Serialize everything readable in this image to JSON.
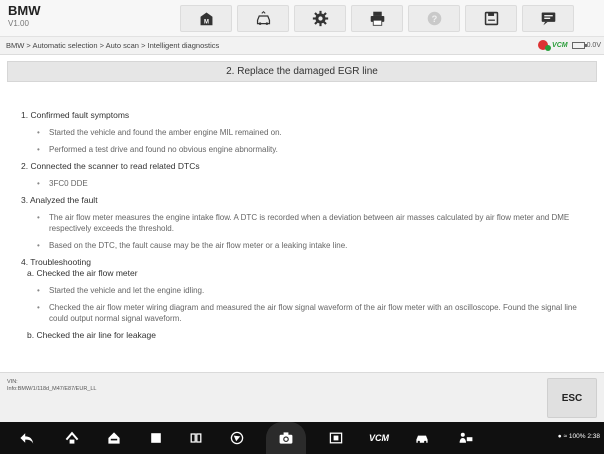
{
  "app": {
    "name": "BMW",
    "version": "V1.00"
  },
  "toolbar": {
    "icons": [
      "home-icon",
      "car-icon",
      "settings-icon",
      "print-icon",
      "help-icon",
      "save-icon",
      "message-icon"
    ]
  },
  "breadcrumb": "BMW > Automatic selection > Auto scan > Intelligent diagnostics",
  "status": {
    "vcm_label": "VCM",
    "voltage": "0.0V"
  },
  "title": "2. Replace the damaged EGR line",
  "content": {
    "s1": "1. Confirmed fault symptoms",
    "s1_b1": "Started the vehicle and found the amber engine MIL remained on.",
    "s1_b2": "Performed a test drive and found no obvious engine abnormality.",
    "s2": "2. Connected the scanner to read related DTCs",
    "s2_b1": "3FC0 DDE",
    "s3": "3. Analyzed the fault",
    "s3_b1": "The air flow meter measures the engine intake flow. A DTC is recorded when a deviation between air masses calculated by air flow meter and DME respectively exceeds the threshold.",
    "s3_b2": "Based on the DTC, the fault cause may be the air flow meter or a leaking intake line.",
    "s4": "4. Troubleshooting",
    "s4a": "a. Checked the air flow meter",
    "s4a_b1": "Started the vehicle and let the engine idling.",
    "s4a_b2": "Checked the air flow meter wiring diagram and measured the air flow signal waveform of the air flow meter with an oscilloscope. Found the signal line could output normal signal waveform.",
    "s4b": "b. Checked the air line for leakage"
  },
  "footer": {
    "vin_label": "VIN:",
    "info": "Info:BMW/1/118d_M47/E87/EUR_LL",
    "esc_label": "ESC"
  },
  "navbar": {
    "vcm_label": "VCM",
    "system_status": "100% 2:38"
  },
  "colors": {
    "accent_green": "#2a9d3a",
    "alert_red": "#d33"
  }
}
